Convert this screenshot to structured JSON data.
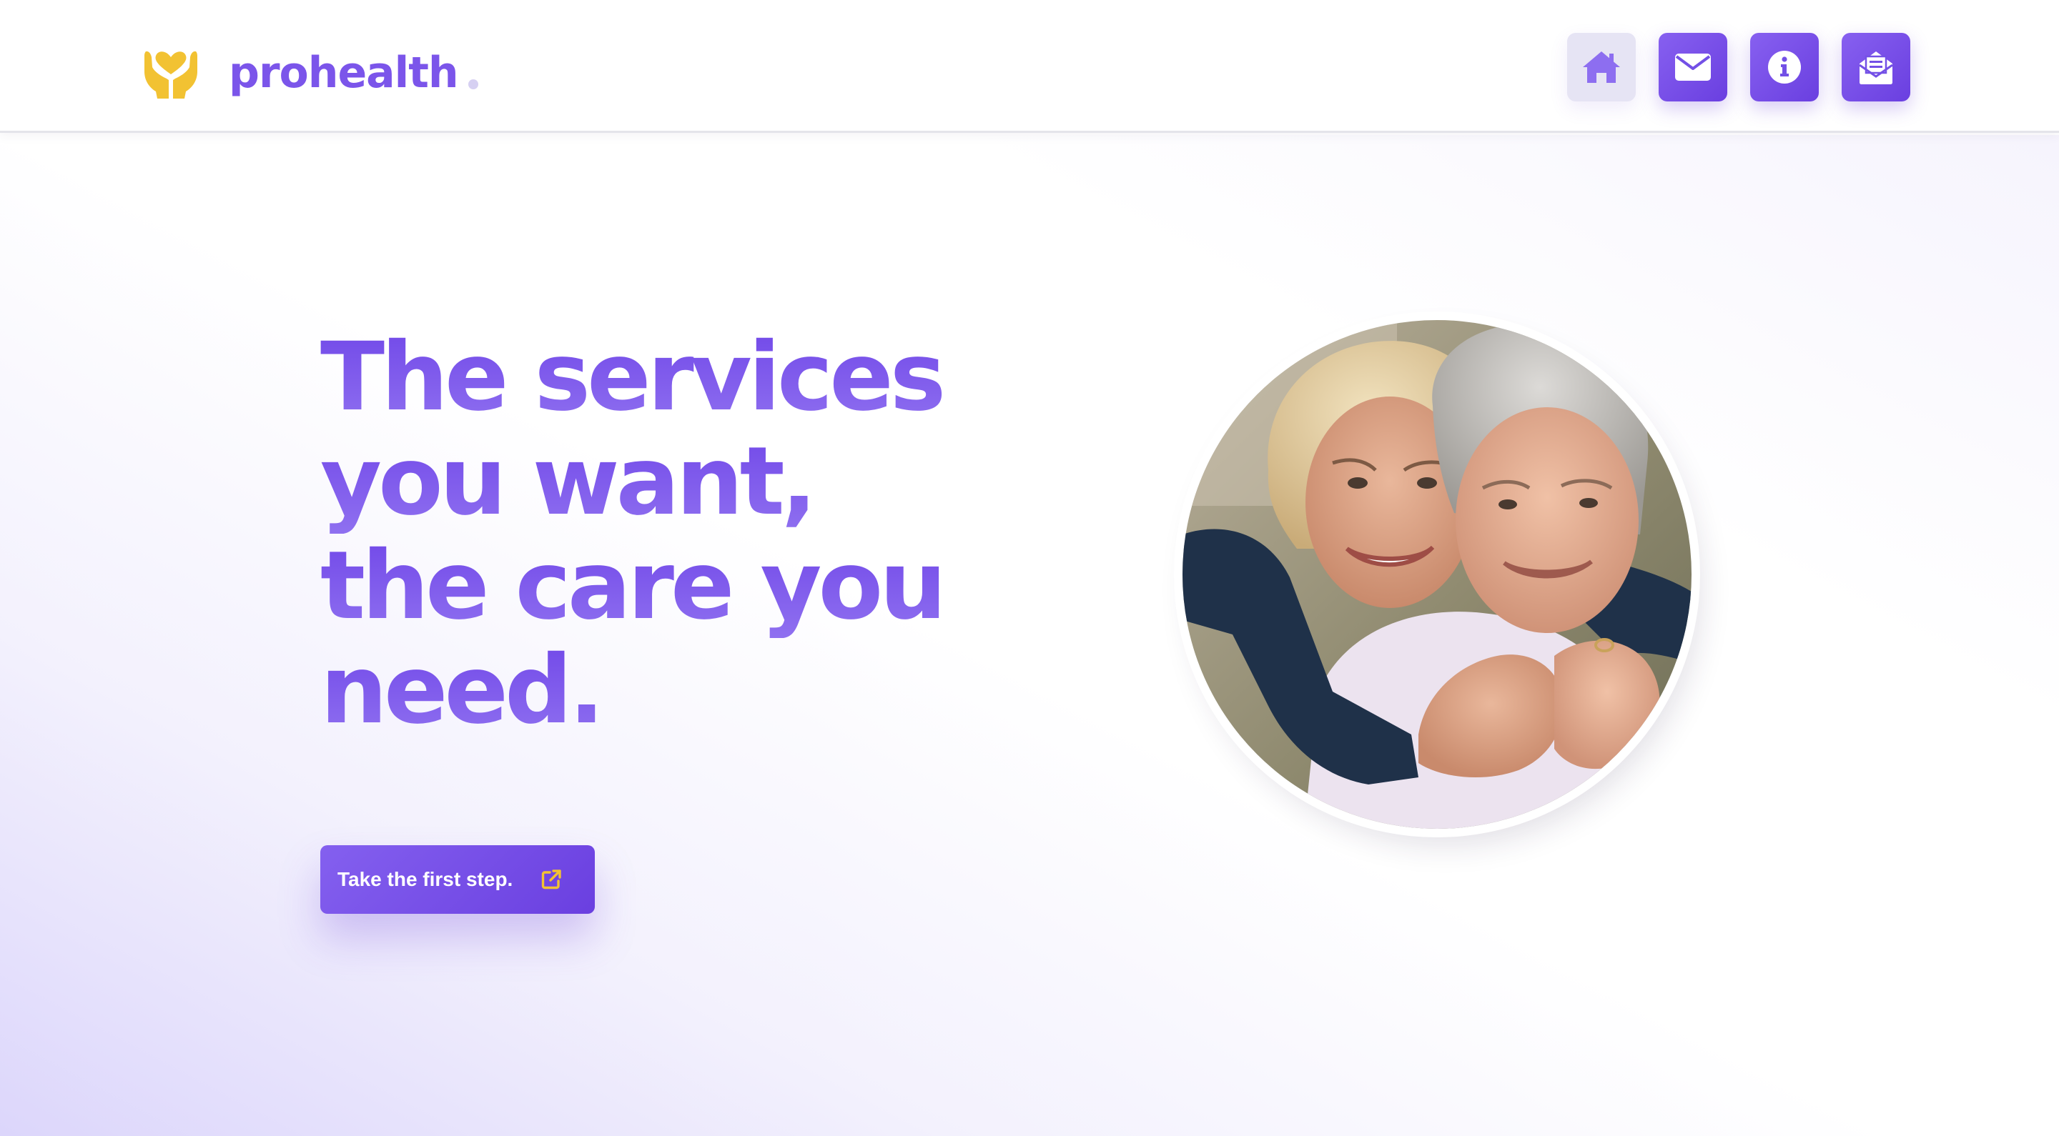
{
  "brand": {
    "name": "prohealth",
    "logo_icon": "hands-heart-icon",
    "colors": {
      "primary": "#7b55ea",
      "accent": "#f2c232",
      "nav_active_bg": "#e6e4f4"
    }
  },
  "nav": {
    "items": [
      {
        "icon": "home-icon",
        "active": true
      },
      {
        "icon": "envelope-icon",
        "active": false
      },
      {
        "icon": "info-icon",
        "active": false
      },
      {
        "icon": "open-envelope-icon",
        "active": false
      }
    ]
  },
  "hero": {
    "headline_lines": [
      "The services",
      "you want,",
      "the care you",
      "need."
    ],
    "cta_label": "Take the first step.",
    "cta_icon": "external-link-icon",
    "image": "photo-two-women-smiling-hugging"
  }
}
